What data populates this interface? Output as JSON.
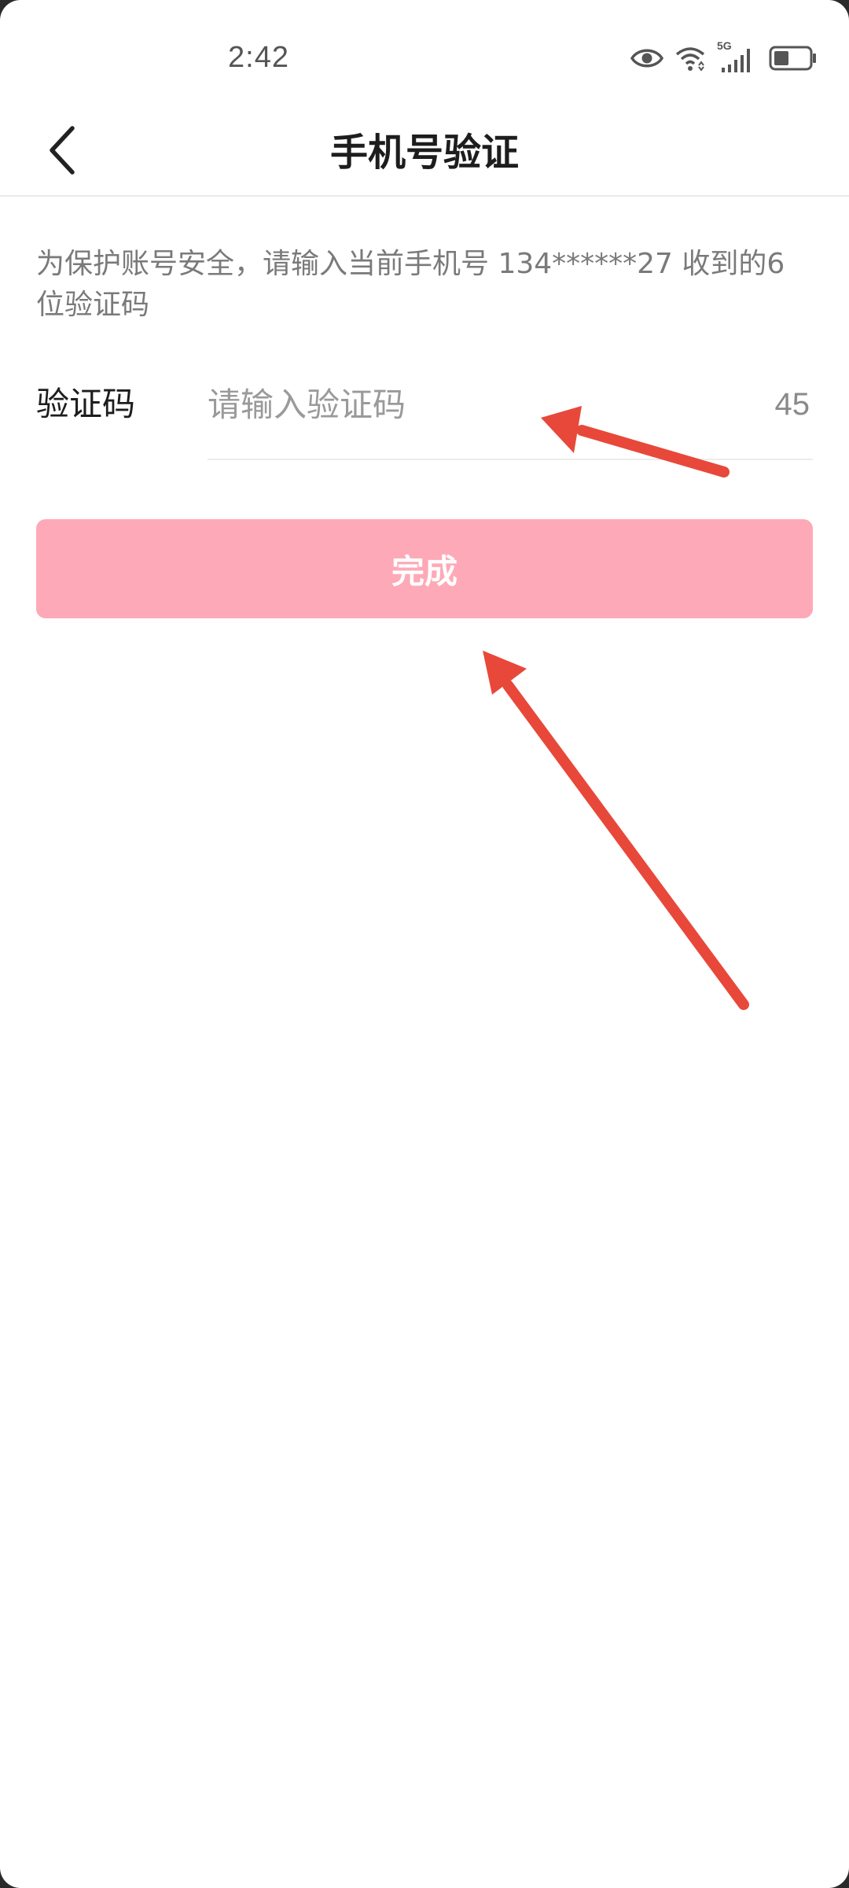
{
  "status_bar": {
    "time": "2:42",
    "network_label": "5G",
    "icons": [
      "eye-icon",
      "wifi-icon",
      "signal-icon",
      "battery-icon"
    ]
  },
  "nav": {
    "title": "手机号验证",
    "back_icon": "chevron-left-icon"
  },
  "hint": "为保护账号安全，请输入当前手机号 134******27 收到的6位验证码",
  "code_field": {
    "label": "验证码",
    "value": "",
    "placeholder": "请输入验证码",
    "countdown": "45"
  },
  "done_button": {
    "label": "完成"
  },
  "colors": {
    "accent_disabled": "#fea9b7",
    "annotation_arrow": "#e8483a"
  }
}
